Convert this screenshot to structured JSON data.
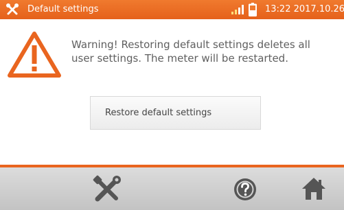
{
  "statusbar": {
    "title": "Default settings",
    "time": "13:22",
    "date": "2017.10.26",
    "icon": "wrench-screwdriver-icon",
    "signal_icon": "signal-strength-icon",
    "battery_icon": "battery-icon"
  },
  "warning": {
    "icon": "warning-triangle-icon",
    "line1": "Warning! Restoring default settings deletes all",
    "line2": "user settings. The meter will be restarted."
  },
  "restore_button": {
    "label": "Restore default settings"
  },
  "bottombar": {
    "settings_icon": "wrench-screwdriver-icon",
    "help_icon": "help-icon",
    "home_icon": "home-icon"
  },
  "colors": {
    "accent": "#e9651f",
    "text": "#5f5f5f",
    "bottombar": "#cfcfcf"
  }
}
